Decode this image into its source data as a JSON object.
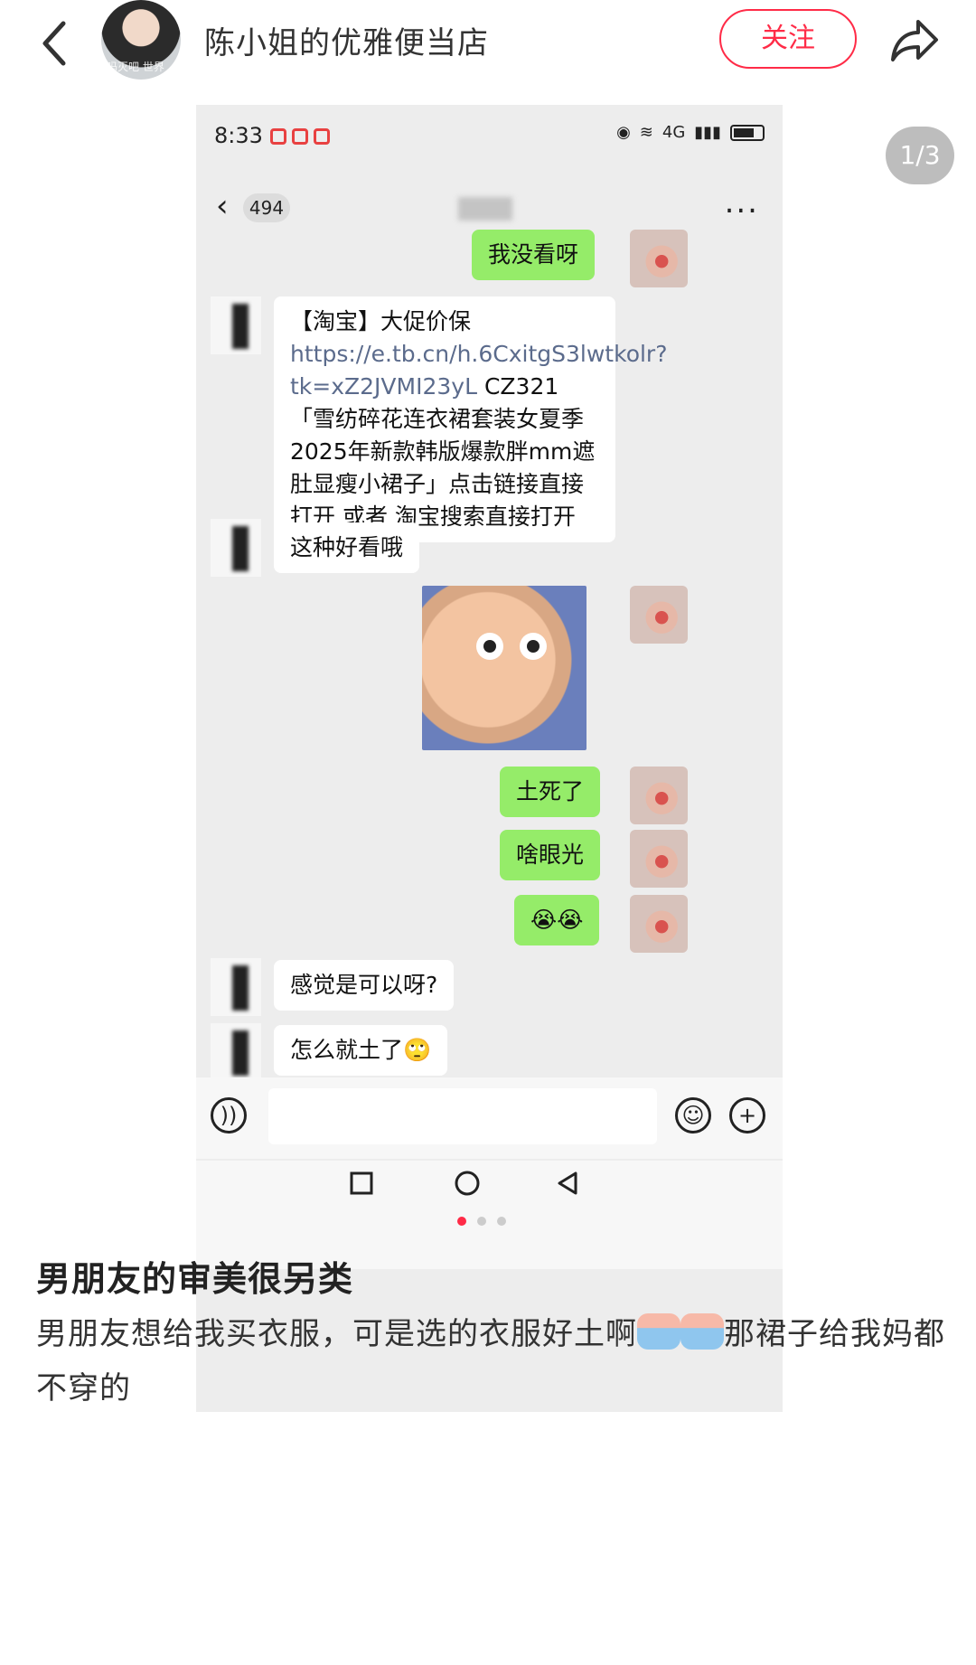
{
  "header": {
    "author_name": "陈小姐的优雅便当店",
    "avatar_watermark": "吗灭吧 世界",
    "follow_label": "关注",
    "image_counter": "1/3"
  },
  "screenshot": {
    "status_time": "8:33",
    "status_network": "4G",
    "chat_badge": "494",
    "chat_more": "...",
    "messages": [
      {
        "side": "me",
        "text": "我没看呀"
      },
      {
        "side": "other",
        "prefix": "【淘宝】大促价保 ",
        "link": "https://e.tb.cn/h.6CxitgS3lwtkolr?tk=xZ2JVMI23yL",
        "suffix": " CZ321 「雪纺碎花连衣裙套装女夏季2025年新款韩版爆款胖mm遮肚显瘦小裙子」点击链接直接打开 或者 淘宝搜索直接打开"
      },
      {
        "side": "other",
        "text": "这种好看哦"
      },
      {
        "side": "me",
        "type": "sticker"
      },
      {
        "side": "me",
        "text": "土死了"
      },
      {
        "side": "me",
        "text": "啥眼光"
      },
      {
        "side": "me",
        "text": "😭😭"
      },
      {
        "side": "other",
        "text": "感觉是可以呀?"
      },
      {
        "side": "other",
        "text": "怎么就土了🙄"
      }
    ]
  },
  "carousel": {
    "count": 3,
    "active": 0
  },
  "post": {
    "title": "男朋友的审美很另类",
    "body_part1": "男朋友想给我买衣服，可是选的衣服好土啊",
    "body_part2": "那裙子给我妈都不穿的"
  },
  "colors": {
    "accent": "#ff2b47",
    "bubble_me": "#95ec69",
    "bubble_other": "#ffffff",
    "chat_bg": "#ededed"
  }
}
